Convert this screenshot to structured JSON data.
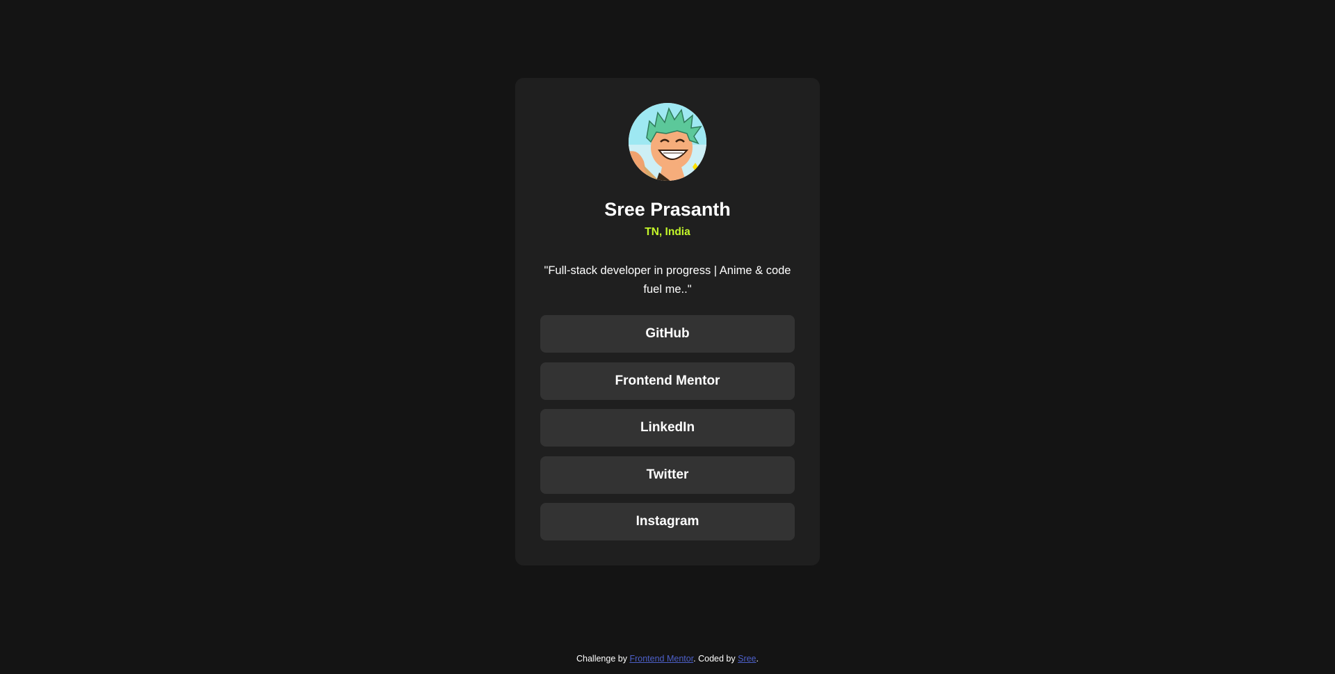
{
  "colors": {
    "page_background": "#141414",
    "card_background": "#1f1f1f",
    "button_background": "#333333",
    "accent_green": "#c4f82a",
    "link_blue": "#4d60c9",
    "text_white": "#ffffff"
  },
  "profile": {
    "avatar_icon": "anime-avatar-icon",
    "name": "Sree Prasanth",
    "location": "TN, India",
    "bio": "\"Full-stack developer in progress | Anime & code fuel me..\""
  },
  "links": [
    {
      "label": "GitHub"
    },
    {
      "label": "Frontend Mentor"
    },
    {
      "label": "LinkedIn"
    },
    {
      "label": "Twitter"
    },
    {
      "label": "Instagram"
    }
  ],
  "attribution": {
    "prefix": "Challenge by ",
    "challenge_link": "Frontend Mentor",
    "middle": ". Coded by ",
    "author_link": "Sree",
    "suffix": "."
  }
}
